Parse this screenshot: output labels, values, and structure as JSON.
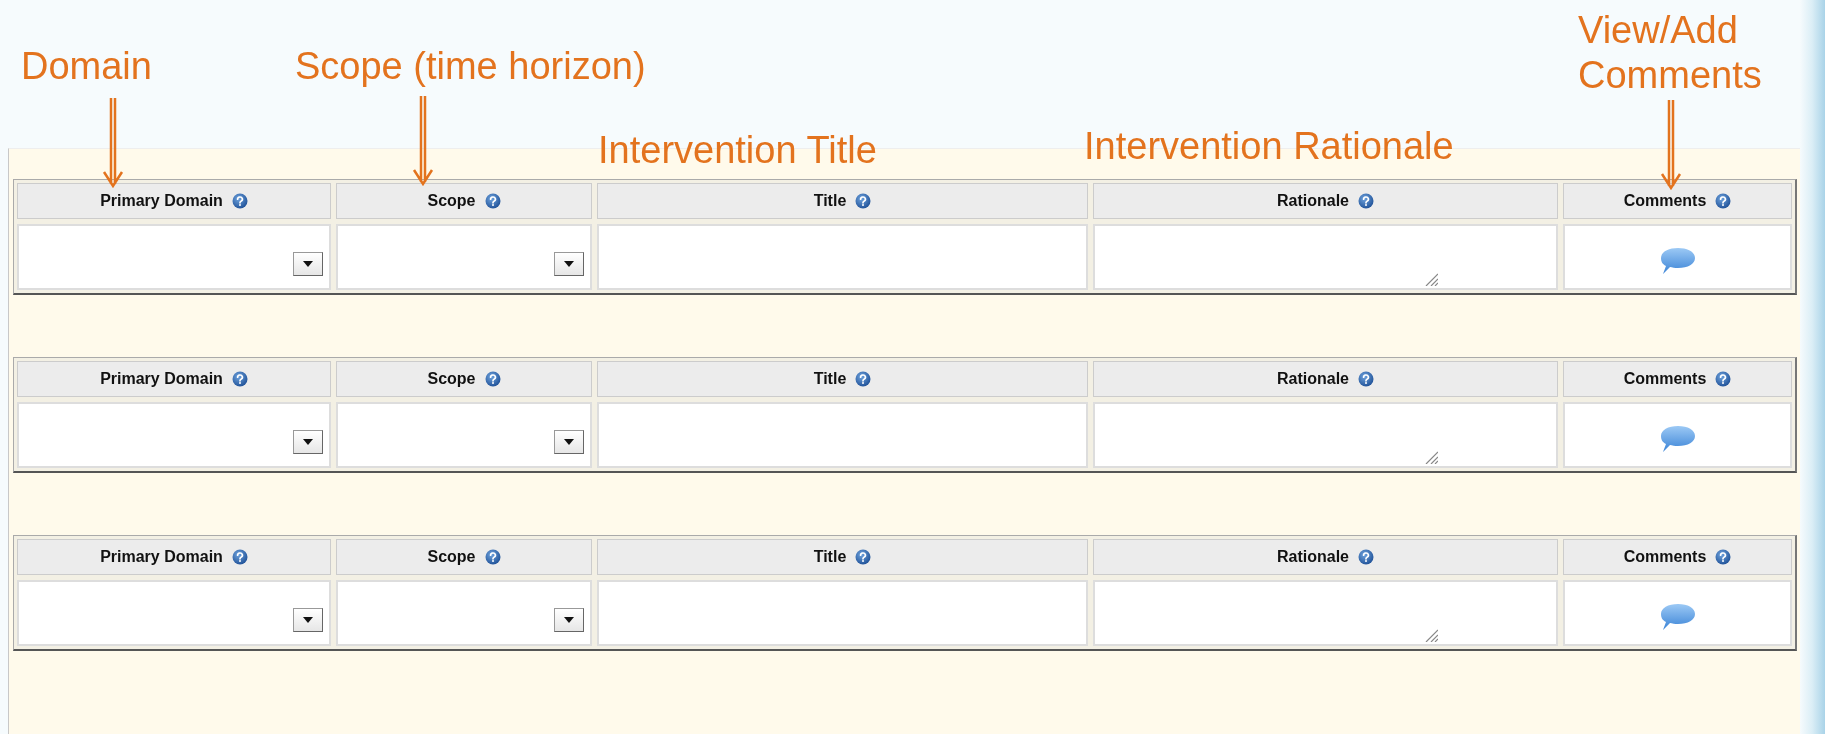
{
  "annotations": [
    {
      "text": "Domain",
      "arrow": true
    },
    {
      "text": "Scope (time horizon)",
      "arrow": true
    },
    {
      "text": "Intervention Title",
      "arrow": false
    },
    {
      "text": "Intervention Rationale",
      "arrow": false
    },
    {
      "text": "View/Add Comments",
      "arrow": true
    }
  ],
  "tables": [
    {
      "columns": [
        {
          "label": "Primary Domain",
          "kind": "dropdown"
        },
        {
          "label": "Scope",
          "kind": "dropdown"
        },
        {
          "label": "Title",
          "kind": "text"
        },
        {
          "label": "Rationale",
          "kind": "textarea"
        },
        {
          "label": "Comments",
          "kind": "comment"
        }
      ]
    },
    {
      "columns": [
        {
          "label": "Primary Domain",
          "kind": "dropdown"
        },
        {
          "label": "Scope",
          "kind": "dropdown"
        },
        {
          "label": "Title",
          "kind": "text"
        },
        {
          "label": "Rationale",
          "kind": "textarea"
        },
        {
          "label": "Comments",
          "kind": "comment"
        }
      ]
    },
    {
      "columns": [
        {
          "label": "Primary Domain",
          "kind": "dropdown"
        },
        {
          "label": "Scope",
          "kind": "dropdown"
        },
        {
          "label": "Title",
          "kind": "text"
        },
        {
          "label": "Rationale",
          "kind": "textarea"
        },
        {
          "label": "Comments",
          "kind": "comment"
        }
      ]
    }
  ]
}
